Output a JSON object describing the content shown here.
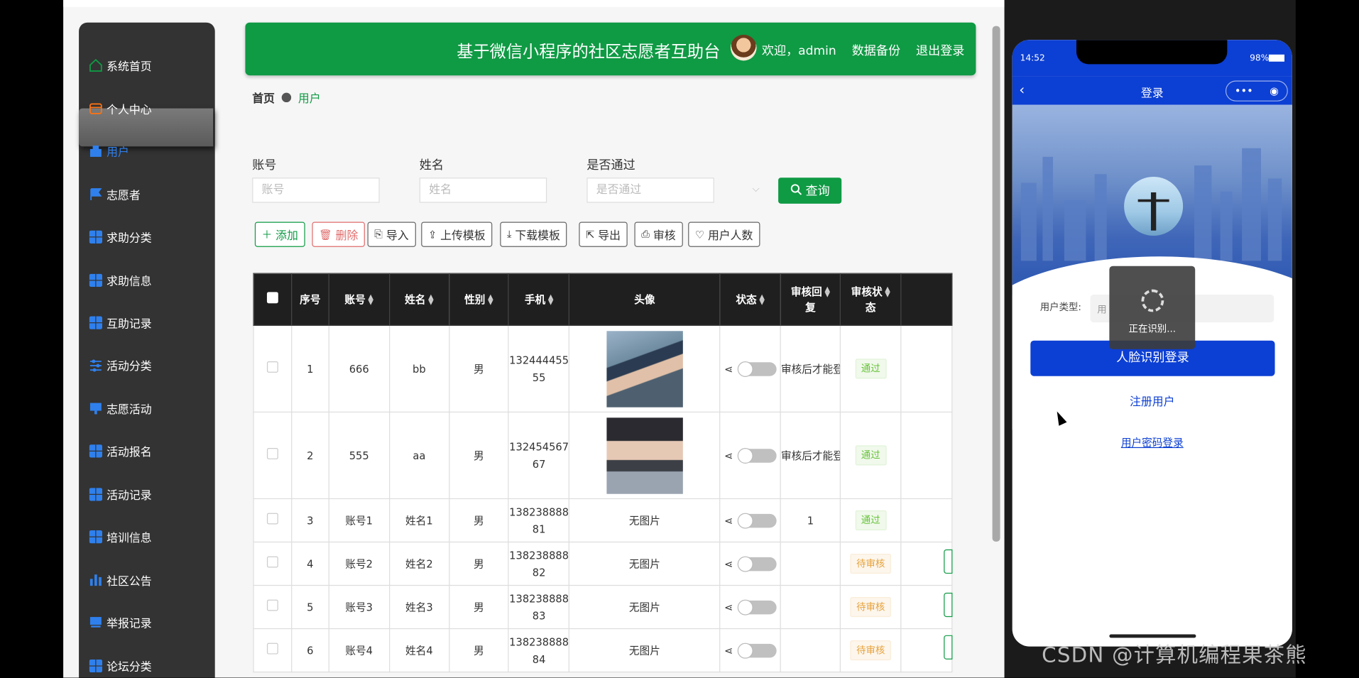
{
  "header": {
    "title": "基于微信小程序的社区志愿者互助",
    "title_tail": "台",
    "welcome": "欢迎，admin",
    "backup": "数据备份",
    "logout": "退出登录"
  },
  "sidebar": {
    "items": [
      {
        "label": "系统首页",
        "icon": "home-icon"
      },
      {
        "label": "个人中心",
        "icon": "wallet-icon"
      },
      {
        "label": "用户",
        "icon": "users-icon",
        "active": true
      },
      {
        "label": "志愿者",
        "icon": "flag-icon"
      },
      {
        "label": "求助分类",
        "icon": "grid-icon"
      },
      {
        "label": "求助信息",
        "icon": "grid-icon"
      },
      {
        "label": "互助记录",
        "icon": "grid-icon"
      },
      {
        "label": "活动分类",
        "icon": "sliders-icon"
      },
      {
        "label": "志愿活动",
        "icon": "monitor-icon"
      },
      {
        "label": "活动报名",
        "icon": "grid-icon"
      },
      {
        "label": "活动记录",
        "icon": "grid-icon"
      },
      {
        "label": "培训信息",
        "icon": "grid-icon"
      },
      {
        "label": "社区公告",
        "icon": "bar-chart-icon"
      },
      {
        "label": "举报记录",
        "icon": "monitor-icon"
      },
      {
        "label": "论坛分类",
        "icon": "grid-icon"
      }
    ]
  },
  "breadcrumb": {
    "home": "首页",
    "current": "用户"
  },
  "search": {
    "account_label": "账号",
    "account_placeholder": "账号",
    "name_label": "姓名",
    "name_placeholder": "姓名",
    "approved_label": "是否通过",
    "approved_placeholder": "是否通过",
    "query_label": "查询"
  },
  "actions": {
    "add": "添加",
    "delete": "删除",
    "import": "导入",
    "upload_template": "上传模板",
    "download_template": "下载模板",
    "export": "导出",
    "review": "审核",
    "user_count": "用户人数"
  },
  "table": {
    "headers": {
      "index": "序号",
      "account": "账号",
      "name": "姓名",
      "gender": "性别",
      "phone": "手机",
      "avatar": "头像",
      "status": "状态",
      "review_reply_1": "审核回",
      "review_reply_2": "复",
      "review_status_1": "审核状",
      "review_status_2": "态"
    },
    "rows": [
      {
        "index": "1",
        "account": "666",
        "name": "bb",
        "gender": "男",
        "phone_1": "132444455",
        "phone_2": "55",
        "avatar": "",
        "reply": "审核后才能登",
        "review_status": "通过"
      },
      {
        "index": "2",
        "account": "555",
        "name": "aa",
        "gender": "男",
        "phone_1": "132454567",
        "phone_2": "67",
        "avatar": "",
        "reply": "审核后才能登",
        "review_status": "通过"
      },
      {
        "index": "3",
        "account": "账号1",
        "name": "姓名1",
        "gender": "男",
        "phone_1": "138238888",
        "phone_2": "81",
        "avatar": "无图片",
        "reply": "1",
        "review_status": "通过"
      },
      {
        "index": "4",
        "account": "账号2",
        "name": "姓名2",
        "gender": "男",
        "phone_1": "138238888",
        "phone_2": "82",
        "avatar": "无图片",
        "reply": "",
        "review_status": "待审核"
      },
      {
        "index": "5",
        "account": "账号3",
        "name": "姓名3",
        "gender": "男",
        "phone_1": "138238888",
        "phone_2": "83",
        "avatar": "无图片",
        "reply": "",
        "review_status": "待审核"
      },
      {
        "index": "6",
        "account": "账号4",
        "name": "姓名4",
        "gender": "男",
        "phone_1": "138238888",
        "phone_2": "84",
        "avatar": "无图片",
        "reply": "",
        "review_status": "待审核"
      }
    ]
  },
  "phone": {
    "time": "14:52",
    "battery": "98%",
    "nav_title": "登录",
    "user_type_label": "用户类型:",
    "user_type_placeholder": "用",
    "loading_text": "正在识别...",
    "face_login": "人脸识别登录",
    "register": "注册用户",
    "password_login": "用户密码登录"
  },
  "watermark": "CSDN @计算机编程果茶熊",
  "colors": {
    "accent": "#0f9a44",
    "sidebar": "#333333",
    "phone_primary": "#0c3fd3"
  }
}
